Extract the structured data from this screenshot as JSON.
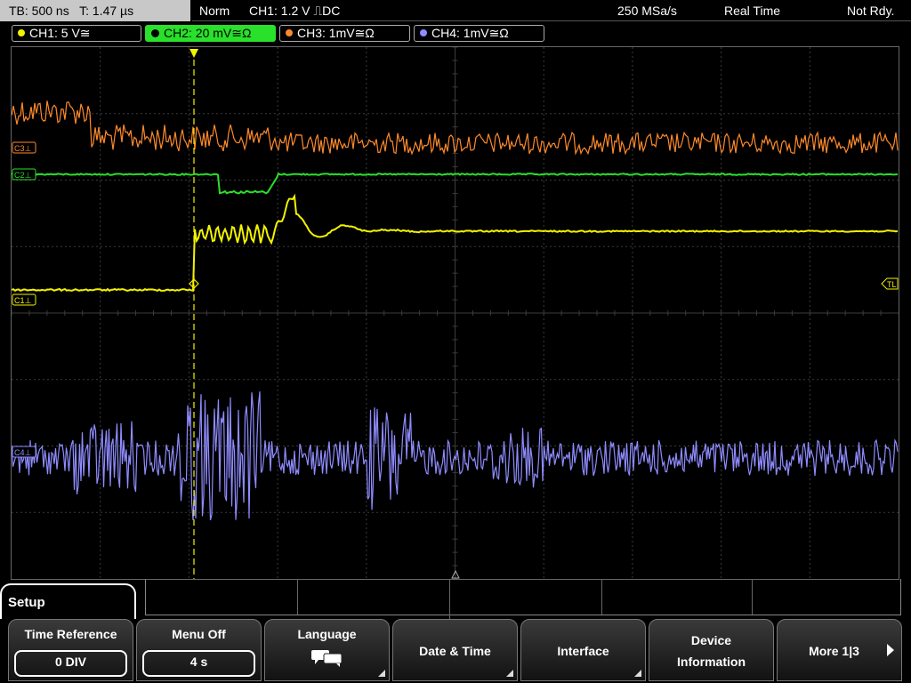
{
  "status": {
    "timebase": "TB: 500 ns",
    "trigger_time": "T: 1.47 µs",
    "mode": "Norm",
    "trigger_info": "CH1: 1.2 V",
    "trigger_slope_coupling": "⎍DC",
    "sample_rate": "250 MSa/s",
    "acquisition": "Real Time",
    "state": "Not Rdy."
  },
  "channels": [
    {
      "label": "CH1: 5 V≅",
      "color": "#f2f200"
    },
    {
      "label": "CH2: 20 mV≅Ω",
      "color": "#29e02a"
    },
    {
      "label": "CH3: 1mV≅Ω",
      "color": "#ff8a2b"
    },
    {
      "label": "CH4: 1mV≅Ω",
      "color": "#8f8cff"
    }
  ],
  "markers": {
    "c3": "C3⊥",
    "c2": "C2⊥",
    "c1": "C1⊥",
    "c4": "C4⊥",
    "trigger_level": "TL"
  },
  "menu": {
    "title": "Setup",
    "softkeys": [
      {
        "label": "Time Reference",
        "value": "0 DIV"
      },
      {
        "label": "Menu Off",
        "value": "4 s"
      },
      {
        "label": "Language",
        "icon": "speech-bubble-icon"
      },
      {
        "label": "Date & Time"
      },
      {
        "label": "Interface"
      },
      {
        "label": "Device",
        "label2": "Information"
      },
      {
        "label": "More 1|3"
      }
    ]
  },
  "colors": {
    "ch1": "#f2f200",
    "ch2": "#29e02a",
    "ch3": "#ff8a2b",
    "ch4": "#8f8cff",
    "grid": "#3c3c3c"
  }
}
